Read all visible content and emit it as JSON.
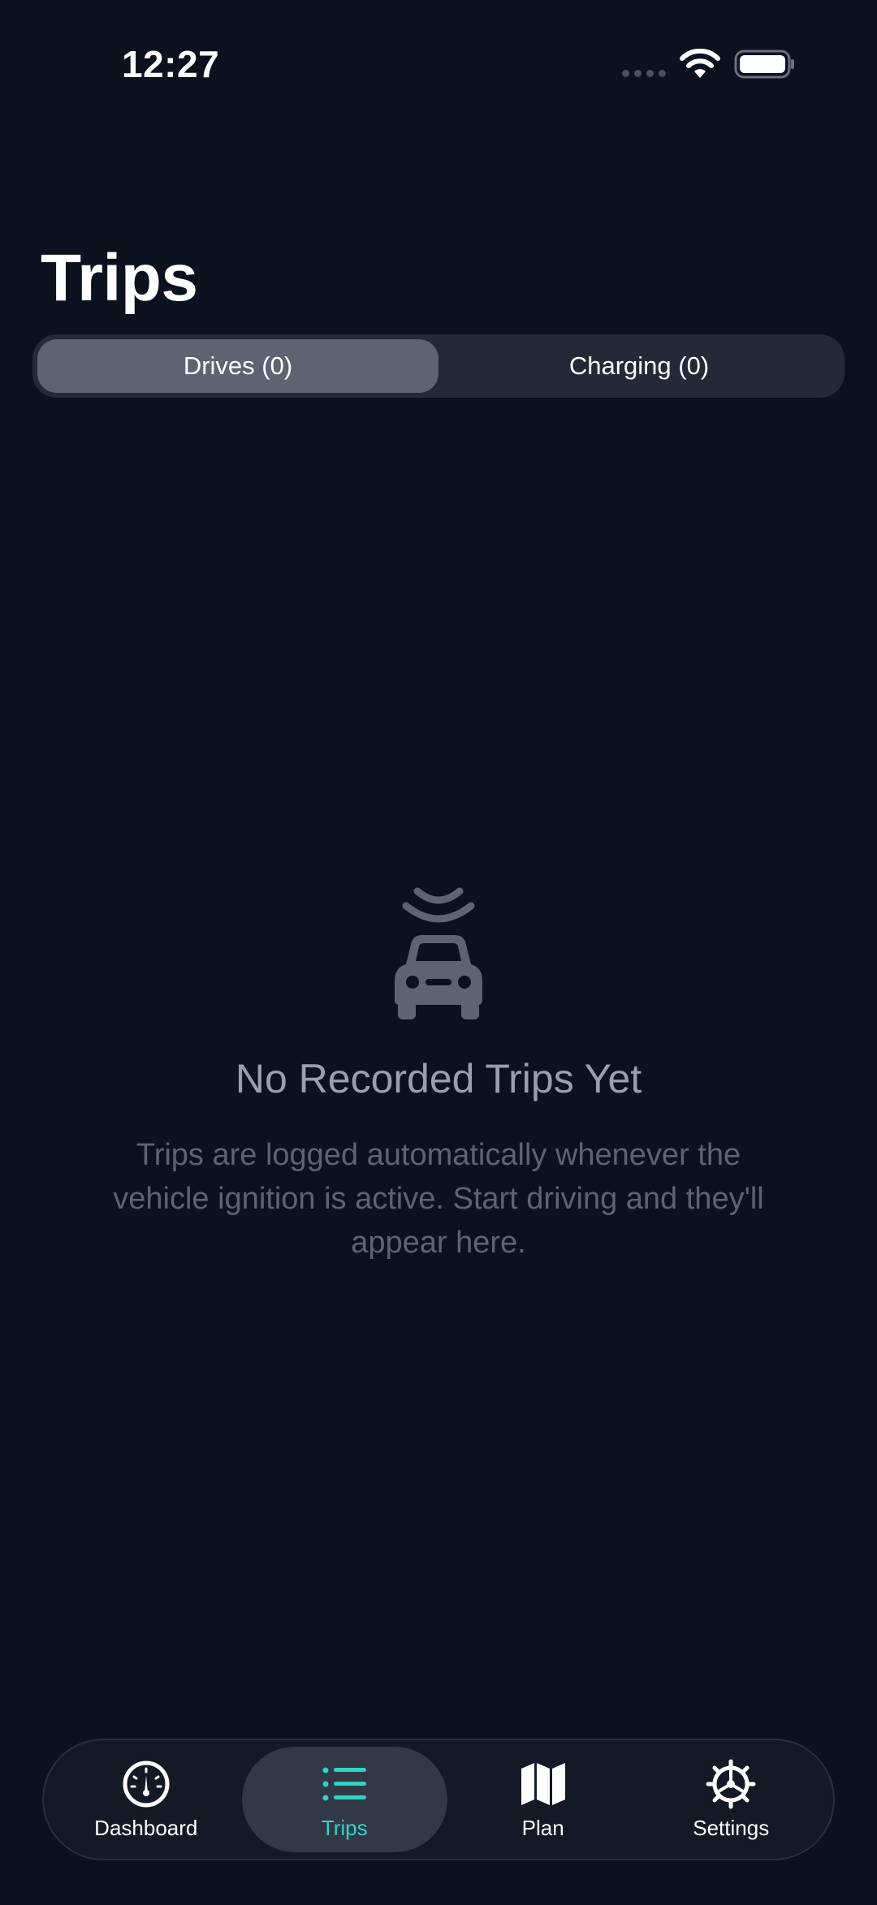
{
  "status_bar": {
    "time": "12:27"
  },
  "header": {
    "title": "Trips"
  },
  "segmented_control": {
    "segments": [
      {
        "label": "Drives (0)",
        "selected": true
      },
      {
        "label": "Charging (0)",
        "selected": false
      }
    ]
  },
  "empty_state": {
    "icon": "car-signal-icon",
    "title": "No Recorded Trips Yet",
    "description": "Trips are logged automatically whenever the vehicle ignition is active. Start driving and they'll appear here."
  },
  "tab_bar": {
    "tabs": [
      {
        "label": "Dashboard",
        "icon": "speedometer-icon",
        "selected": false
      },
      {
        "label": "Trips",
        "icon": "list-icon",
        "selected": true
      },
      {
        "label": "Plan",
        "icon": "map-icon",
        "selected": false
      },
      {
        "label": "Settings",
        "icon": "gear-icon",
        "selected": false
      }
    ]
  },
  "colors": {
    "background": "#0b111d",
    "accent": "#2fd3c8",
    "segment_track": "#242937",
    "segment_active": "#5e6371"
  }
}
